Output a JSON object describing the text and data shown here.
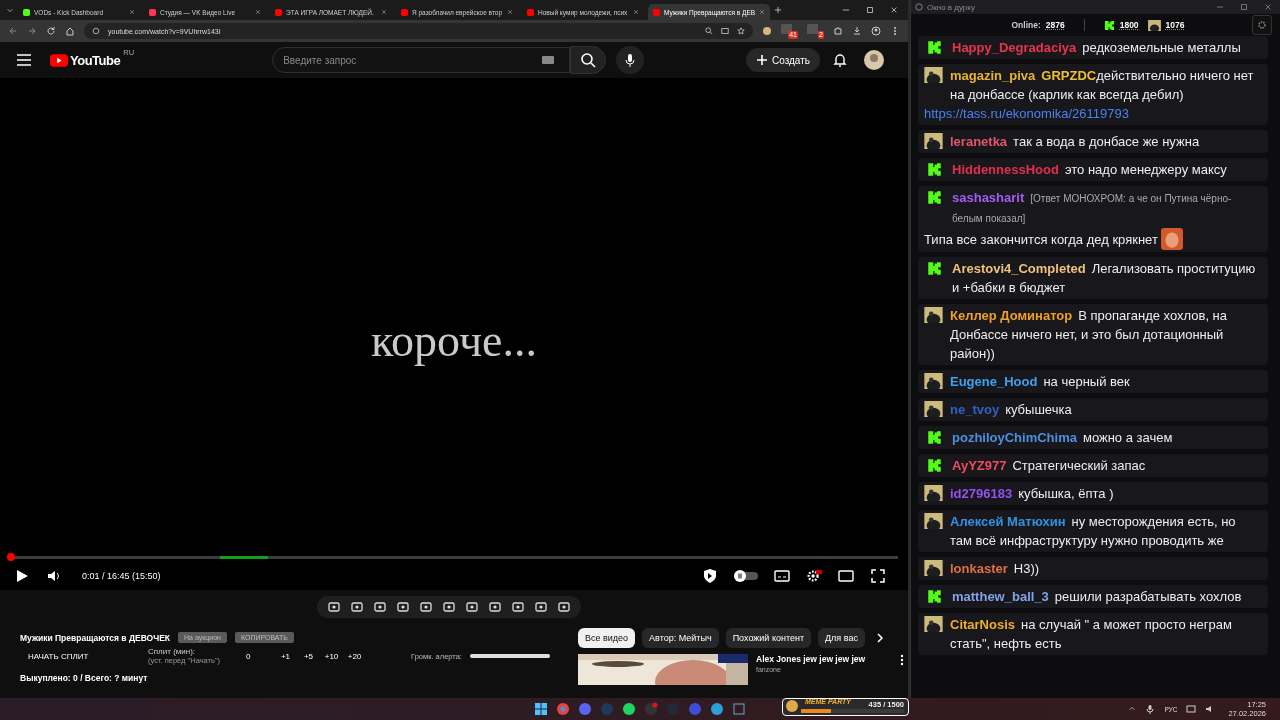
{
  "browser": {
    "tabs": [
      {
        "title": "VODs - Kick Dashboard",
        "kind": "kick",
        "selected": false
      },
      {
        "title": "Студия — VK Видео Live",
        "kind": "vk",
        "selected": false
      },
      {
        "title": "ЭТА ИГРА ЛОМАЕТ ЛЮДЕЙ.",
        "kind": "youtube",
        "selected": false
      },
      {
        "title": "Я разоблачил еврейское втор",
        "kind": "youtube",
        "selected": false
      },
      {
        "title": "Новый кумир молодежи, псих",
        "kind": "youtube",
        "selected": false
      },
      {
        "title": "Мужики Превращаются в ДЕВ",
        "kind": "youtube",
        "selected": true
      }
    ],
    "address": "youtube.com/watch?v=9VUhrrw143I",
    "extension_badges": [
      "41",
      "2"
    ]
  },
  "youtube": {
    "logo": "YouTube",
    "region": "RU",
    "search": {
      "placeholder": "Введите запрос"
    },
    "create_label": "Создать",
    "player": {
      "caption": "короче...",
      "progress": {
        "level": 0.003
      },
      "time": "0:01 / 16:45 (15:50)"
    },
    "video_title": "Мужики Превращаются в ДЕВОЧЕК",
    "actions": [
      "На аукцион",
      "КОПИРОВАТЬ"
    ],
    "split": {
      "start_label": "НАЧАТЬ СПЛИТ",
      "label": "Сплит (мин):",
      "hint": "(уст. перед \"Начать\")",
      "value": "0",
      "steps": [
        "+1",
        "+5",
        "+10",
        "+20"
      ]
    },
    "alert_volume": {
      "label": "Громк. алерта:",
      "level": 1
    },
    "summary": "Выкуплено: 0 / Всего: ? минут",
    "chips": [
      {
        "label": "Все видео",
        "selected": true
      },
      {
        "label": "Автор: Мейтыч",
        "selected": false
      },
      {
        "label": "Похожий контент",
        "selected": false
      },
      {
        "label": "Для вас",
        "selected": false
      }
    ],
    "suggestion": {
      "title": "Alex Jones jew jew jew jew",
      "channel": "fanzone"
    }
  },
  "chat": {
    "title": "Окно в дурку",
    "online_label": "Online:",
    "online": "2876",
    "kick_count": "1800",
    "other_count": "1076",
    "messages": [
      {
        "kind": "kick",
        "user": "Happy_Degradaciya",
        "color": "#e8354e",
        "text": "редкоземельные металлы"
      },
      {
        "kind": "avatar",
        "user": "magazin_piva",
        "color": "#e9b530",
        "mention": "GRPZDC",
        "text": "действительно ничего нет на донбассе (карлик как всегда дебил)",
        "link": "https://tass.ru/ekonomika/26119793"
      },
      {
        "kind": "avatar",
        "user": "leranetka",
        "color": "#e2566b",
        "text": "так а вода в донбасе же нужна"
      },
      {
        "kind": "kick",
        "user": "HiddennessHood",
        "color": "#e2304c",
        "text": "это надо менеджеру максу"
      },
      {
        "kind": "kick",
        "user": "sashasharit",
        "color": "#a55cf2",
        "reply": "[Ответ МОНОХРОМ: а че он Путина чёрно-белым показал]",
        "text": "Типа все закончится когда дед крякнет",
        "emote": true
      },
      {
        "kind": "kick",
        "user": "Arestovi4_Completed",
        "color": "#f1c27a",
        "text": "Легализовать проституцию и +бабки в бюджет"
      },
      {
        "kind": "avatar",
        "user": "Келлер Доминатор",
        "color": "#f0a028",
        "text": "В пропаганде хохлов, на Донбассе ничего нет, и это был дотационный район))"
      },
      {
        "kind": "avatar",
        "user": "Eugene_Hood",
        "color": "#3ea2f0",
        "text": "на черный век"
      },
      {
        "kind": "avatar",
        "user": "ne_tvoy",
        "color": "#2f62c4",
        "text": "кубышечка"
      },
      {
        "kind": "kick",
        "user": "pozhiloyChimChima",
        "color": "#4f8fe0",
        "text": "можно а зачем"
      },
      {
        "kind": "kick",
        "user": "AyYZ977",
        "color": "#ee4d60",
        "text": "Стратегический запас"
      },
      {
        "kind": "avatar",
        "user": "id2796183",
        "color": "#9452f2",
        "text": "кубышка, ёпта )"
      },
      {
        "kind": "avatar",
        "user": "Алексей Матюхин",
        "color": "#3192e2",
        "text": "ну месторождения есть, но там всё инфраструктуру нужно проводить же"
      },
      {
        "kind": "avatar",
        "user": "lonkaster",
        "color": "#e0703f",
        "text": "Н3))"
      },
      {
        "kind": "kick",
        "user": "matthew_ball_3",
        "color": "#84a3e6",
        "text": "решили разрабатывать хохлов"
      },
      {
        "kind": "avatar",
        "user": "CitarNosis",
        "color": "#f0b02c",
        "text": "на случай \" а может просто неграм стать\", нефть есть"
      }
    ]
  },
  "widget": {
    "title": "MEME PARTY",
    "count": "435 / 1500",
    "level": 0.29
  },
  "tray": {
    "language": "РУС",
    "time": "17:25",
    "date": "27.02.2026"
  }
}
